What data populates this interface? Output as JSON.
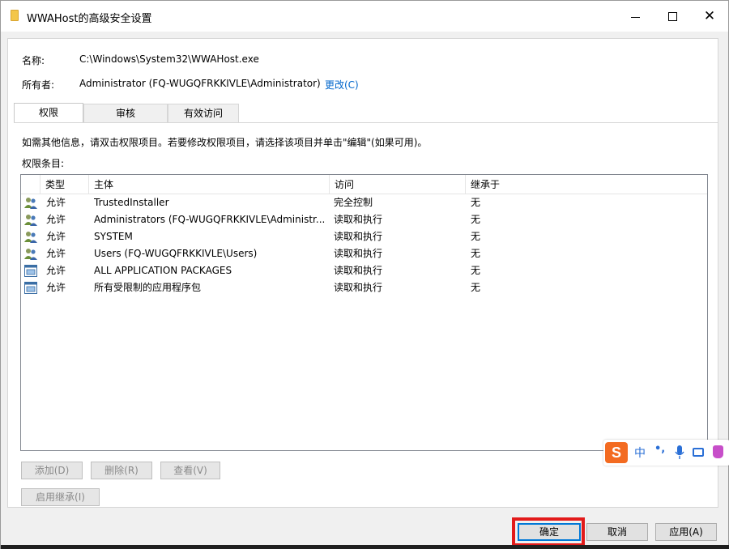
{
  "window": {
    "title": "WWAHost的高级安全设置"
  },
  "info": {
    "name_label": "名称:",
    "name_value": "C:\\Windows\\System32\\WWAHost.exe",
    "owner_label": "所有者:",
    "owner_value": "Administrator (FQ-WUGQFRKKIVLE\\Administrator)",
    "change_link": "更改(C)"
  },
  "tabs": [
    {
      "label": "权限",
      "active": true
    },
    {
      "label": "审核",
      "active": false
    },
    {
      "label": "有效访问",
      "active": false
    }
  ],
  "hint": "如需其他信息，请双击权限项目。若要修改权限项目，请选择该项目并单击\"编辑\"(如果可用)。",
  "entries_label": "权限条目:",
  "table": {
    "columns": [
      "类型",
      "主体",
      "访问",
      "继承于"
    ],
    "rows": [
      {
        "icon": "user-group-icon",
        "type": "允许",
        "principal": "TrustedInstaller",
        "access": "完全控制",
        "inherited": "无"
      },
      {
        "icon": "user-group-icon",
        "type": "允许",
        "principal": "Administrators (FQ-WUGQFRKKIVLE\\Administr...",
        "access": "读取和执行",
        "inherited": "无"
      },
      {
        "icon": "user-group-icon",
        "type": "允许",
        "principal": "SYSTEM",
        "access": "读取和执行",
        "inherited": "无"
      },
      {
        "icon": "user-group-icon",
        "type": "允许",
        "principal": "Users (FQ-WUGQFRKKIVLE\\Users)",
        "access": "读取和执行",
        "inherited": "无"
      },
      {
        "icon": "app-package-icon",
        "type": "允许",
        "principal": "ALL APPLICATION PACKAGES",
        "access": "读取和执行",
        "inherited": "无"
      },
      {
        "icon": "app-package-icon",
        "type": "允许",
        "principal": "所有受限制的应用程序包",
        "access": "读取和执行",
        "inherited": "无"
      }
    ]
  },
  "buttons": {
    "add": "添加(D)",
    "remove": "删除(R)",
    "view": "查看(V)",
    "enable_inheritance": "启用继承(I)",
    "ok": "确定",
    "cancel": "取消",
    "apply": "应用(A)"
  },
  "ime": {
    "logo": "S",
    "mode": "中",
    "punct": "•,",
    "icons": [
      "microphone-icon",
      "keyboard-icon",
      "skin-icon"
    ]
  },
  "colors": {
    "link": "#0066cc",
    "highlight": "#e21a1a",
    "ime_logo": "#f36b21"
  }
}
